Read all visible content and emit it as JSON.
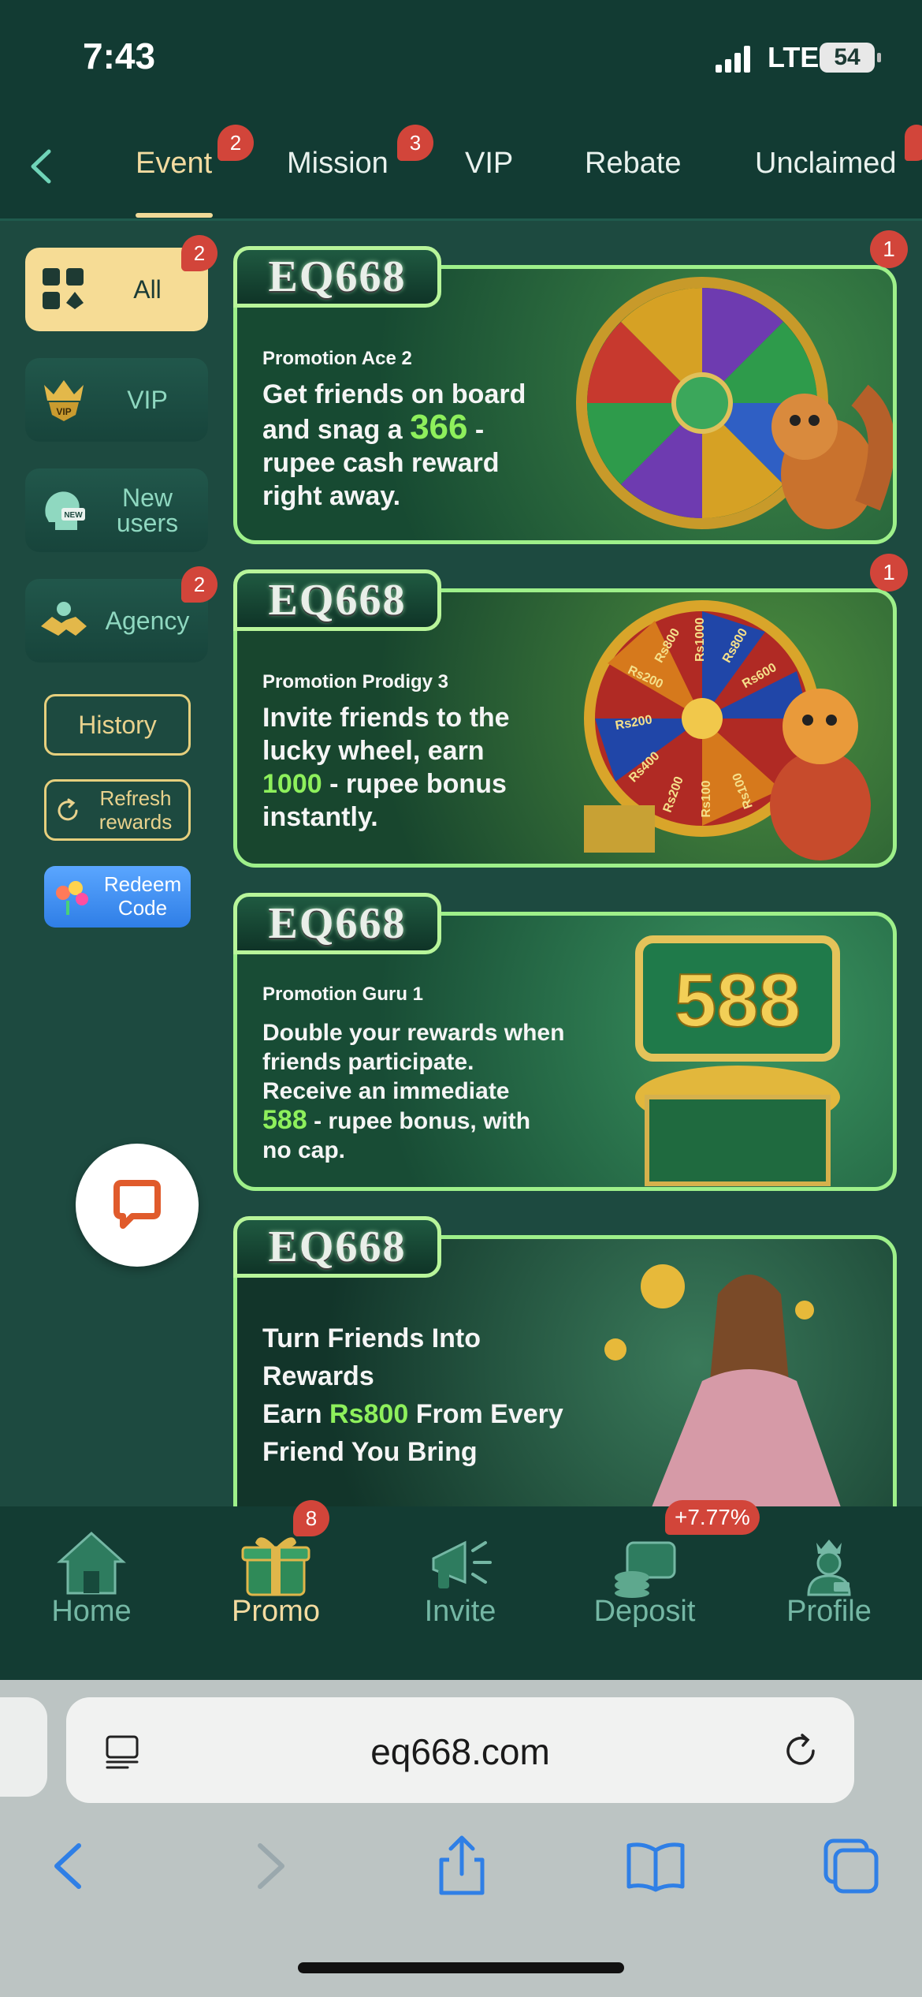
{
  "status_bar": {
    "time": "7:43",
    "network": "LTE",
    "battery": "54"
  },
  "tabs": {
    "items": [
      {
        "label": "Event",
        "badge": "2"
      },
      {
        "label": "Mission",
        "badge": "3"
      },
      {
        "label": "VIP"
      },
      {
        "label": "Rebate"
      },
      {
        "label": "Unclaimed"
      }
    ]
  },
  "sidebar": {
    "items": [
      {
        "label": "All",
        "badge": "2",
        "icon": "grid-icon"
      },
      {
        "label": "VIP",
        "icon": "crown-shield-icon"
      },
      {
        "label": "New\nusers",
        "icon": "new-user-head-icon"
      },
      {
        "label": "Agency",
        "badge": "2",
        "icon": "handshake-icon"
      }
    ],
    "history": "History",
    "refresh": "Refresh rewards",
    "redeem": "Redeem Code"
  },
  "banners": [
    {
      "logo": "EQ668",
      "subtitle": "Promotion Ace 2",
      "text_parts": [
        "Get friends on board",
        "and snag a ",
        "366",
        " -",
        "rupee cash reward",
        "right away."
      ],
      "badge": "1"
    },
    {
      "logo": "EQ668",
      "subtitle": "Promotion Prodigy 3",
      "text_parts": [
        "Invite friends to the",
        "lucky wheel, earn",
        "1000",
        " - rupee bonus",
        "instantly."
      ],
      "badge": "1",
      "wheel_labels": [
        "Rs800",
        "Rs1000",
        "Rs800",
        "Rs600",
        "Rs200",
        "Rs200",
        "Rs400",
        "Rs200",
        "Rs100",
        "Rs100"
      ]
    },
    {
      "logo": "EQ668",
      "subtitle": "Promotion Guru 1",
      "text_parts": [
        "Double your rewards when",
        "friends participate.",
        "Receive an immediate",
        "588",
        " - rupee bonus, with",
        "no cap."
      ],
      "chest_number": "588"
    },
    {
      "logo": "EQ668",
      "text_parts": [
        "Turn Friends Into",
        "Rewards",
        "Earn ",
        "Rs800",
        " From Every",
        "Friend You Bring"
      ]
    }
  ],
  "bottom_nav": {
    "items": [
      {
        "label": "Home",
        "icon": "house-icon"
      },
      {
        "label": "Promo",
        "icon": "gift-icon",
        "badge": "8"
      },
      {
        "label": "Invite",
        "icon": "megaphone-icon"
      },
      {
        "label": "Deposit",
        "icon": "wallet-coins-icon",
        "badge": "+7.77%"
      },
      {
        "label": "Profile",
        "icon": "vip-profile-icon"
      }
    ]
  },
  "browser": {
    "url": "eq668.com"
  }
}
